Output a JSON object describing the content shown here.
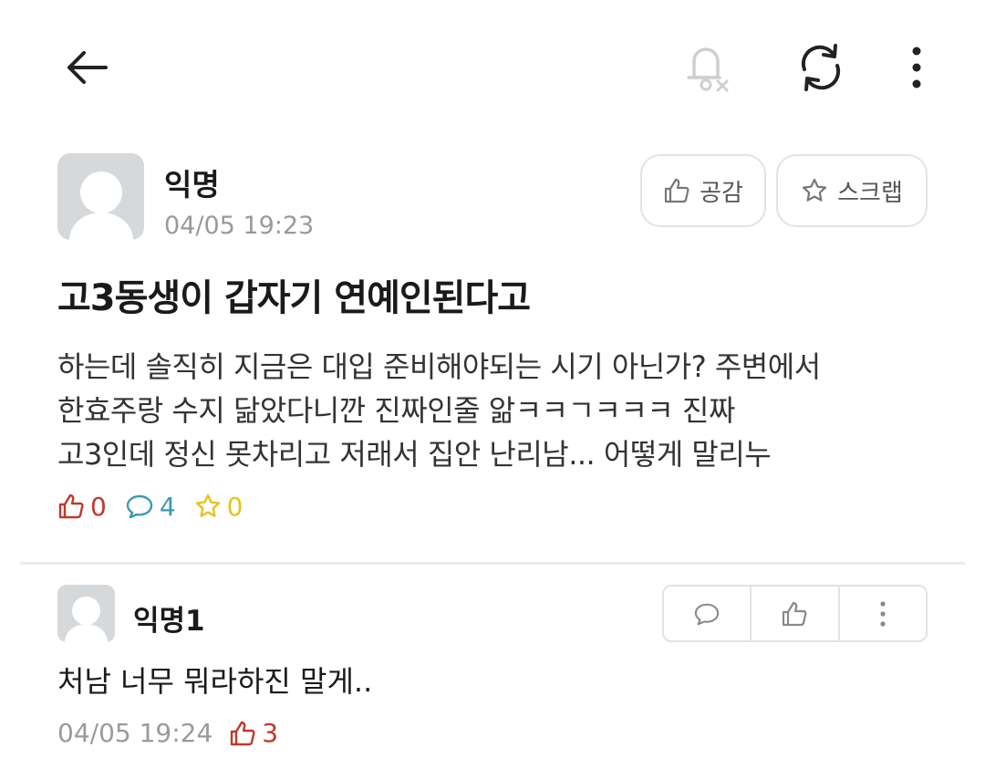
{
  "toolbar": {
    "back_icon": "arrow-left-icon",
    "notify_icon": "bell-off-icon",
    "refresh_icon": "refresh-icon",
    "more_icon": "more-vertical-icon"
  },
  "post": {
    "author": "익명",
    "time": "04/05 19:23",
    "like_button": "공감",
    "scrap_button": "스크랩",
    "title": "고3동생이 갑자기 연예인된다고",
    "body_lines": [
      "하는데 솔직히 지금은 대입 준비해야되는 시기 아닌가? 주변에서",
      "한효주랑 수지 닮았다니깐 진짜인줄 앎ㅋㅋㄱㅋㅋㅋ 진짜",
      "고3인데 정신 못차리고 저래서 집안 난리남... 어떻게 말리누"
    ],
    "stats": {
      "likes": "0",
      "comments": "4",
      "scraps": "0"
    }
  },
  "comments": [
    {
      "author": "익명1",
      "text": "처남 너무 뭐라하진 말게..",
      "time": "04/05 19:24",
      "likes": "3"
    }
  ],
  "colors": {
    "like": "#c0392b",
    "comment": "#3a9ab0",
    "scrap": "#e6c21f",
    "muted": "#9a9a9a"
  }
}
